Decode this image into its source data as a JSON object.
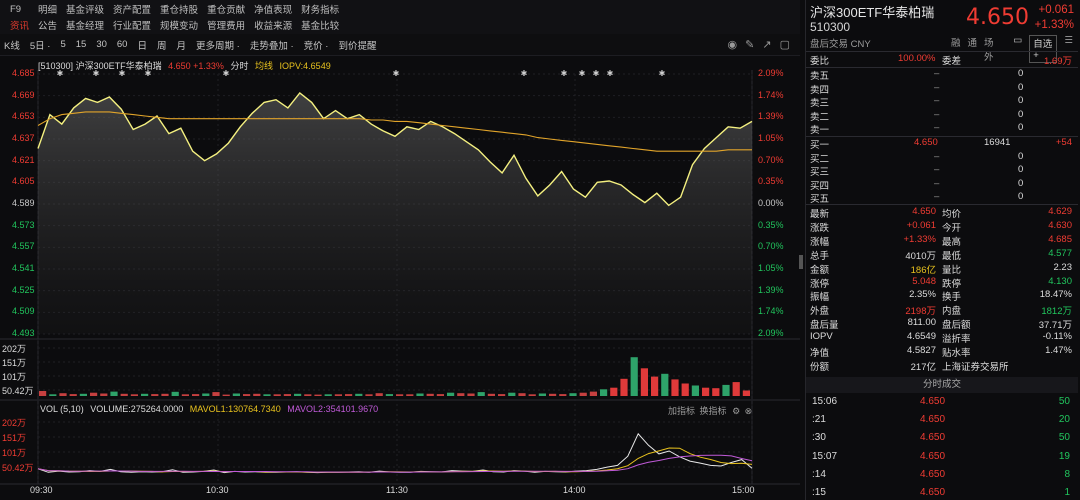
{
  "nav": {
    "row1": [
      "F9",
      "明细",
      "基金评级",
      "资产配置",
      "重仓持股",
      "重仓贡献",
      "净值表现",
      "财务指标"
    ],
    "row2": [
      "资讯",
      "公告",
      "基金经理",
      "行业配置",
      "规模变动",
      "管理费用",
      "收益来源",
      "基金比较"
    ]
  },
  "toolbar": {
    "items": [
      "K线",
      "5日 ·",
      "5",
      "15",
      "30",
      "60",
      "日",
      "周",
      "月",
      "更多周期 ·",
      "走势叠加 ·",
      "竞价 ·",
      "到价提醒"
    ],
    "tools": [
      "◉",
      "✎",
      "↗",
      "▢"
    ]
  },
  "chart_header": {
    "code": "[510300]",
    "name": "沪深300ETF华泰柏瑞",
    "price": "4.650",
    "change": "+1.33%",
    "mode": "分时",
    "avg_label": "均线",
    "iopv": "IOPV:4.6549"
  },
  "price_axis": [
    "4.685",
    "4.669",
    "4.653",
    "4.637",
    "4.621",
    "4.605",
    "4.589",
    "4.573",
    "4.557",
    "4.541",
    "4.525",
    "4.509",
    "4.493"
  ],
  "pct_axis": [
    "2.09%",
    "1.74%",
    "1.39%",
    "1.05%",
    "0.70%",
    "0.35%",
    "0.00%",
    "0.35%",
    "0.70%",
    "1.05%",
    "1.39%",
    "1.74%",
    "2.09%"
  ],
  "vol_axis": [
    "202万",
    "151万",
    "101万",
    "50.42万"
  ],
  "vol2_axis": [
    "202万",
    "151万",
    "101万",
    "50.42万"
  ],
  "vol_header": {
    "label": "VOL (5,10)",
    "volume": "VOLUME:275264.0000",
    "mavol1": "MAVOL1:130764.7340",
    "mavol2": "MAVOL2:354101.9670",
    "add": "加指标",
    "switch": "换指标"
  },
  "time_axis": [
    "09:30",
    "10:30",
    "11:30",
    "14:00",
    "15:00"
  ],
  "chart_data": {
    "type": "line",
    "x_ticks": [
      "09:30",
      "10:30",
      "11:30",
      "14:00",
      "15:00"
    ],
    "ylim": [
      4.493,
      4.685
    ],
    "prev_close": 4.589,
    "series": [
      {
        "name": "分时",
        "color": "#f4f080",
        "values": [
          4.63,
          4.655,
          4.648,
          4.66,
          4.667,
          4.664,
          4.668,
          4.659,
          4.644,
          4.648,
          4.654,
          4.641,
          4.645,
          4.628,
          4.621,
          4.626,
          4.634,
          4.646,
          4.656,
          4.664,
          4.666,
          4.66,
          4.671,
          4.664,
          4.652,
          4.658,
          4.652,
          4.655,
          4.648,
          4.643,
          4.639,
          4.646,
          4.644,
          4.65,
          4.646,
          4.641,
          4.635,
          4.629,
          4.62,
          4.612,
          4.625,
          4.608,
          4.595,
          4.603,
          4.613,
          4.6,
          4.594,
          4.605,
          4.606,
          4.603,
          4.596,
          4.59,
          4.597,
          4.588,
          4.594,
          4.618,
          4.63,
          4.638,
          4.646,
          4.645,
          4.65
        ]
      },
      {
        "name": "均线",
        "color": "#e1a42a",
        "values": [
          4.647,
          4.652,
          4.655,
          4.656,
          4.657,
          4.657,
          4.657,
          4.656,
          4.655,
          4.654,
          4.653,
          4.652,
          4.652,
          4.652,
          4.652,
          4.652,
          4.652,
          4.652,
          4.652,
          4.652,
          4.652,
          4.652,
          4.652,
          4.652,
          4.652,
          4.652,
          4.652,
          4.652,
          4.651,
          4.651,
          4.65,
          4.65,
          4.649,
          4.648,
          4.647,
          4.646,
          4.645,
          4.644,
          4.643,
          4.642,
          4.641,
          4.64,
          4.638,
          4.637,
          4.636,
          4.635,
          4.634,
          4.633,
          4.632,
          4.631,
          4.63,
          4.629,
          4.628,
          4.628,
          4.628,
          4.628,
          4.628,
          4.628,
          4.629,
          4.629,
          4.629
        ]
      }
    ],
    "volume_ylim": [
      0,
      202
    ],
    "volume_values": [
      18,
      6,
      10,
      7,
      8,
      12,
      9,
      16,
      8,
      6,
      8,
      7,
      8,
      15,
      6,
      7,
      9,
      14,
      5,
      9,
      7,
      8,
      6,
      6,
      7,
      8,
      6,
      5,
      6,
      6,
      7,
      8,
      6,
      10,
      7,
      6,
      6,
      9,
      8,
      7,
      12,
      10,
      9,
      14,
      8,
      7,
      12,
      10,
      6,
      9,
      8,
      7,
      10,
      12,
      16,
      24,
      30,
      62,
      140,
      100,
      70,
      80,
      60,
      45,
      38,
      30,
      28,
      40,
      50,
      20
    ]
  },
  "right": {
    "name": "沪深300ETF华泰柏瑞",
    "code": "510300",
    "price": "4.650",
    "change": "+0.061",
    "change_pct": "+1.33%",
    "sub": "盘后交易 CNY",
    "tools": [
      "融",
      "通",
      "场外"
    ],
    "watch_btn": "自选 +",
    "weibi_label": "委比",
    "weibi_val": "100.00%",
    "weicha_label": "委差",
    "weicha_val": "1.69万",
    "asks": [
      {
        "label": "卖五",
        "price": "–",
        "vol": "0"
      },
      {
        "label": "卖四",
        "price": "–",
        "vol": "0"
      },
      {
        "label": "卖三",
        "price": "–",
        "vol": "0"
      },
      {
        "label": "卖二",
        "price": "–",
        "vol": "0"
      },
      {
        "label": "卖一",
        "price": "–",
        "vol": "0"
      }
    ],
    "bids": [
      {
        "label": "买一",
        "price": "4.650",
        "vol": "16941",
        "chg": "+54"
      },
      {
        "label": "买二",
        "price": "–",
        "vol": "0",
        "chg": ""
      },
      {
        "label": "买三",
        "price": "–",
        "vol": "0",
        "chg": ""
      },
      {
        "label": "买四",
        "price": "–",
        "vol": "0",
        "chg": ""
      },
      {
        "label": "买五",
        "price": "–",
        "vol": "0",
        "chg": ""
      }
    ],
    "stats": [
      {
        "l1": "最新",
        "v1": "4.650",
        "c1": "red",
        "l2": "均价",
        "v2": "4.629",
        "c2": "red"
      },
      {
        "l1": "涨跌",
        "v1": "+0.061",
        "c1": "red",
        "l2": "今开",
        "v2": "4.630",
        "c2": "red"
      },
      {
        "l1": "涨幅",
        "v1": "+1.33%",
        "c1": "red",
        "l2": "最高",
        "v2": "4.685",
        "c2": "red"
      },
      {
        "l1": "总手",
        "v1": "4010万",
        "c1": "white",
        "l2": "最低",
        "v2": "4.577",
        "c2": "green"
      },
      {
        "l1": "金额",
        "v1": "186亿",
        "c1": "yellow",
        "l2": "量比",
        "v2": "2.23",
        "c2": "white"
      },
      {
        "l1": "涨停",
        "v1": "5.048",
        "c1": "red",
        "l2": "跌停",
        "v2": "4.130",
        "c2": "green"
      },
      {
        "l1": "振幅",
        "v1": "2.35%",
        "c1": "white",
        "l2": "换手",
        "v2": "18.47%",
        "c2": "white"
      },
      {
        "l1": "外盘",
        "v1": "2198万",
        "c1": "red",
        "l2": "内盘",
        "v2": "1812万",
        "c2": "green"
      },
      {
        "l1": "盘后量",
        "v1": "811.00",
        "c1": "white",
        "l2": "盘后额",
        "v2": "37.71万",
        "c2": "white"
      },
      {
        "l1": "IOPV",
        "v1": "4.6549",
        "c1": "white",
        "l2": "溢折率",
        "v2": "-0.11%",
        "c2": "white"
      },
      {
        "l1": "净值",
        "v1": "4.5827",
        "c1": "white",
        "l2": "贴水率",
        "v2": "1.47%",
        "c2": "white"
      },
      {
        "l1": "份额",
        "v1": "217亿",
        "c1": "white",
        "l2": "上海证券交易所",
        "v2": "",
        "c2": "white"
      }
    ],
    "trades_title": "分时成交",
    "trades": [
      {
        "time": "15:06",
        "price": "4.650",
        "vol": "50"
      },
      {
        "time": ":21",
        "price": "4.650",
        "vol": "20"
      },
      {
        "time": ":30",
        "price": "4.650",
        "vol": "50"
      },
      {
        "time": "15:07",
        "price": "4.650",
        "vol": "19"
      },
      {
        "time": ":14",
        "price": "4.650",
        "vol": "8"
      },
      {
        "time": ":15",
        "price": "4.650",
        "vol": "1"
      }
    ]
  }
}
